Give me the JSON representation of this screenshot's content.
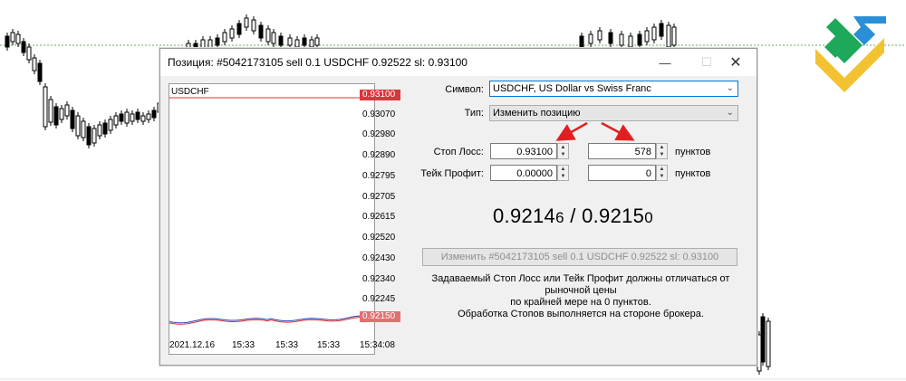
{
  "window": {
    "title": "Позиция: #5042173105 sell 0.1 USDCHF 0.92522 sl: 0.93100"
  },
  "mini_chart": {
    "symbol": "USDCHF",
    "price_levels": [
      "0.93100",
      "0.93070",
      "0.92980",
      "0.92890",
      "0.92795",
      "0.92705",
      "0.92615",
      "0.92520",
      "0.92430",
      "0.92340",
      "0.92245",
      "0.92150"
    ],
    "sl_price_tag": "0.93100",
    "current_price_tag": "0.92150",
    "time_labels": [
      "2021.12.16",
      "15:33",
      "15:33",
      "15:33",
      "15:34:08"
    ],
    "sl_color": "#e03030",
    "bid_color": "#e03030",
    "ask_color": "#2d3db5"
  },
  "form": {
    "symbol_label": "Символ:",
    "symbol_value": "USDCHF, US Dollar vs Swiss Franc",
    "type_label": "Тип:",
    "type_value": "Изменить позицию",
    "stop_loss_label": "Стоп Лосс:",
    "stop_loss_price": "0.93100",
    "stop_loss_points": "578",
    "take_profit_label": "Тейк Профит:",
    "take_profit_price": "0.00000",
    "take_profit_points": "0",
    "points_unit": "пунктов"
  },
  "quote": {
    "bid_main": "0.9214",
    "bid_small": "6",
    "separator": " / ",
    "ask_main": "0.9215",
    "ask_small": "0"
  },
  "modify_button": {
    "label": "Изменить #5042173105 sell 0.1 USDCHF 0.92522 sl: 0.93100"
  },
  "note": {
    "line1": "Задаваемый Стоп Лосс или Тейк Профит должны отличаться от рыночной цены",
    "line2": "по крайней мере на 0 пунктов.",
    "line3": "Обработка Стопов выполняется на стороне брокера."
  },
  "annotation": {
    "arrow_color": "#e02020"
  },
  "logo": {
    "colors": [
      "#1ea85a",
      "#2a8fd6",
      "#f2c230"
    ]
  }
}
